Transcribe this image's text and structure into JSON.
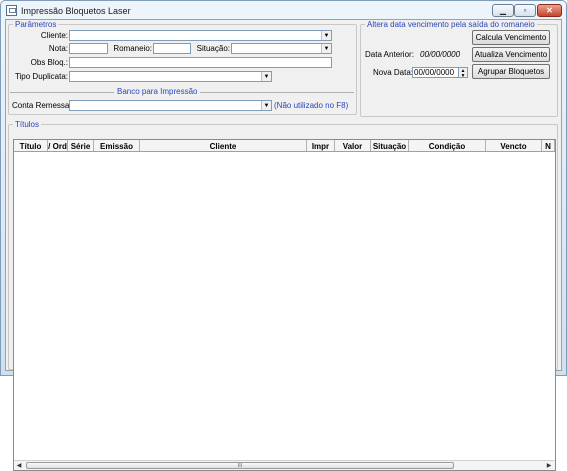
{
  "window": {
    "title": "Impressão Bloquetos Laser",
    "minimize_glyph": "▁",
    "maximize_glyph": "▫",
    "close_glyph": "✕"
  },
  "parametros": {
    "legend": "Parâmetros",
    "cliente_label": "Cliente:",
    "cliente_value": "",
    "nota_label": "Nota:",
    "nota_value": "",
    "romaneio_label": "Romaneio:",
    "romaneio_value": "",
    "situacao_label": "Situação:",
    "situacao_value": "",
    "obs_label": "Obs Bloq.:",
    "obs_value": "",
    "tipo_label": "Tipo Duplicata:",
    "tipo_value": "",
    "banco_title": "Banco para Impressão",
    "conta_label": "Conta Remessa:",
    "conta_value": "",
    "conta_note": "(Não utilizado no F8)"
  },
  "vencimento": {
    "legend": "Altera data vencimento pela saída do romaneio",
    "data_anterior_label": "Data Anterior:",
    "data_anterior_value": "00/00/0000",
    "nova_data_label": "Nova Data:",
    "nova_data_value": "00/00/0000",
    "calcula_label": "Calcula Vencimento",
    "atualiza_label": "Atualiza Vencimento",
    "agrupar_label": "Agrupar Bloquetos"
  },
  "titulos": {
    "legend": "Títulos",
    "columns": [
      "Título",
      "/ Ord",
      "Série",
      "Emissão",
      "Cliente",
      "Impr",
      "Valor",
      "Situação",
      "Condição",
      "Vencto",
      "N"
    ],
    "rows": [],
    "scroll_grip": "III"
  }
}
